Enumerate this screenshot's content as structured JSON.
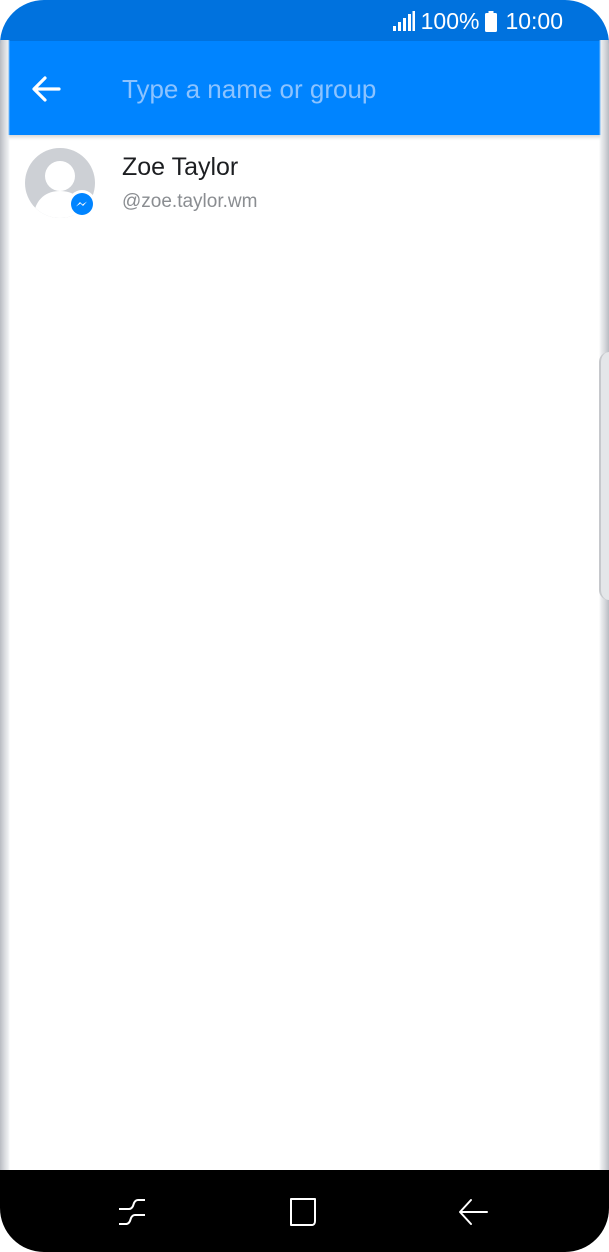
{
  "status_bar": {
    "battery_percent": "100%",
    "time": "10:00",
    "icons": [
      "signal-icon",
      "battery-icon"
    ]
  },
  "app_bar": {
    "back_icon": "arrow-left-icon",
    "search_placeholder": "Type a name or group",
    "search_value": ""
  },
  "contacts": [
    {
      "name": "Zoe Taylor",
      "handle": "@zoe.taylor.wm",
      "badge_icon": "messenger-icon"
    }
  ],
  "nav_bar": {
    "icons": [
      "recents-icon",
      "home-icon",
      "back-icon"
    ]
  },
  "colors": {
    "status_bar": "#0072de",
    "app_bar": "#0084ff",
    "placeholder": "#8cc3ff",
    "badge": "#0084ff",
    "avatar": "#cdd0d5"
  }
}
